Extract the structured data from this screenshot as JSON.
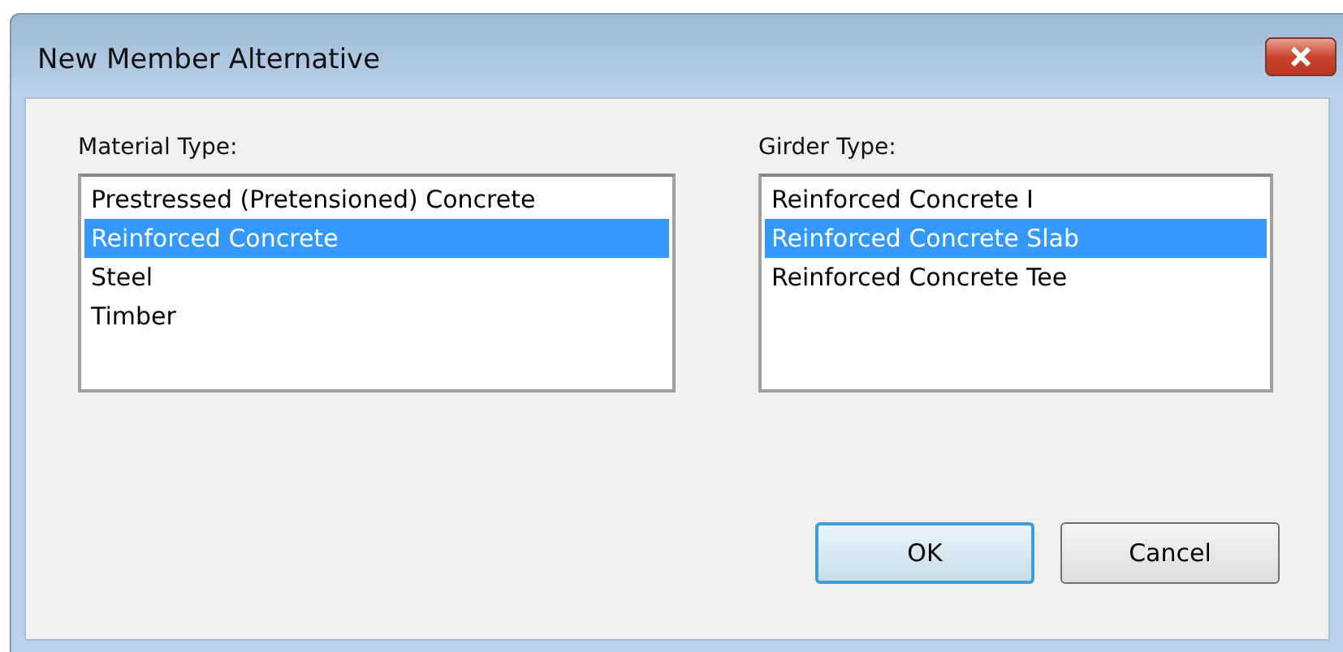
{
  "window": {
    "title": "New Member Alternative"
  },
  "lists": [
    {
      "label": "Material Type:",
      "items": [
        {
          "text": "Prestressed (Pretensioned) Concrete",
          "selected": false
        },
        {
          "text": "Reinforced Concrete",
          "selected": true
        },
        {
          "text": "Steel",
          "selected": false
        },
        {
          "text": "Timber",
          "selected": false
        }
      ]
    },
    {
      "label": "Girder Type:",
      "items": [
        {
          "text": "Reinforced Concrete I",
          "selected": false
        },
        {
          "text": "Reinforced Concrete Slab",
          "selected": true
        },
        {
          "text": "Reinforced Concrete Tee",
          "selected": false
        }
      ]
    }
  ],
  "buttons": [
    {
      "label": "OK",
      "default": true
    },
    {
      "label": "Cancel",
      "default": false
    }
  ]
}
